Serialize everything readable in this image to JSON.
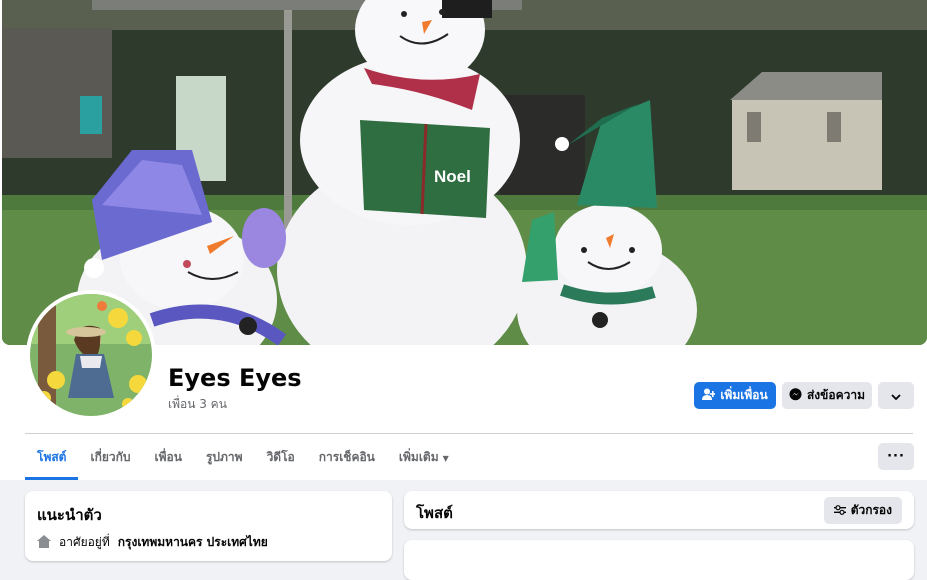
{
  "profile": {
    "name": "Eyes Eyes",
    "friends_count": "เพื่อน 3 คน"
  },
  "cover": {
    "sign_text": "Noel"
  },
  "actions": {
    "add_friend": "เพิ่มเพื่อน",
    "message": "ส่งข้อความ",
    "more_icon": "chevron-down-icon"
  },
  "tabs": [
    {
      "label": "โพสต์",
      "active": true
    },
    {
      "label": "เกี่ยวกับ"
    },
    {
      "label": "เพื่อน"
    },
    {
      "label": "รูปภาพ"
    },
    {
      "label": "วิดีโอ"
    },
    {
      "label": "การเช็คอิน"
    },
    {
      "label": "เพิ่มเติม"
    }
  ],
  "intro": {
    "title": "แนะนำตัว",
    "lives_prefix": "อาศัยอยู่ที่",
    "lives_place": "กรุงเทพมหานคร ประเทศไทย"
  },
  "posts": {
    "title": "โพสต์",
    "filter_label": "ตัวกรอง"
  },
  "colors": {
    "accent": "#1b74e4",
    "bg": "#f0f2f5",
    "secondary_btn": "#e4e6eb"
  }
}
